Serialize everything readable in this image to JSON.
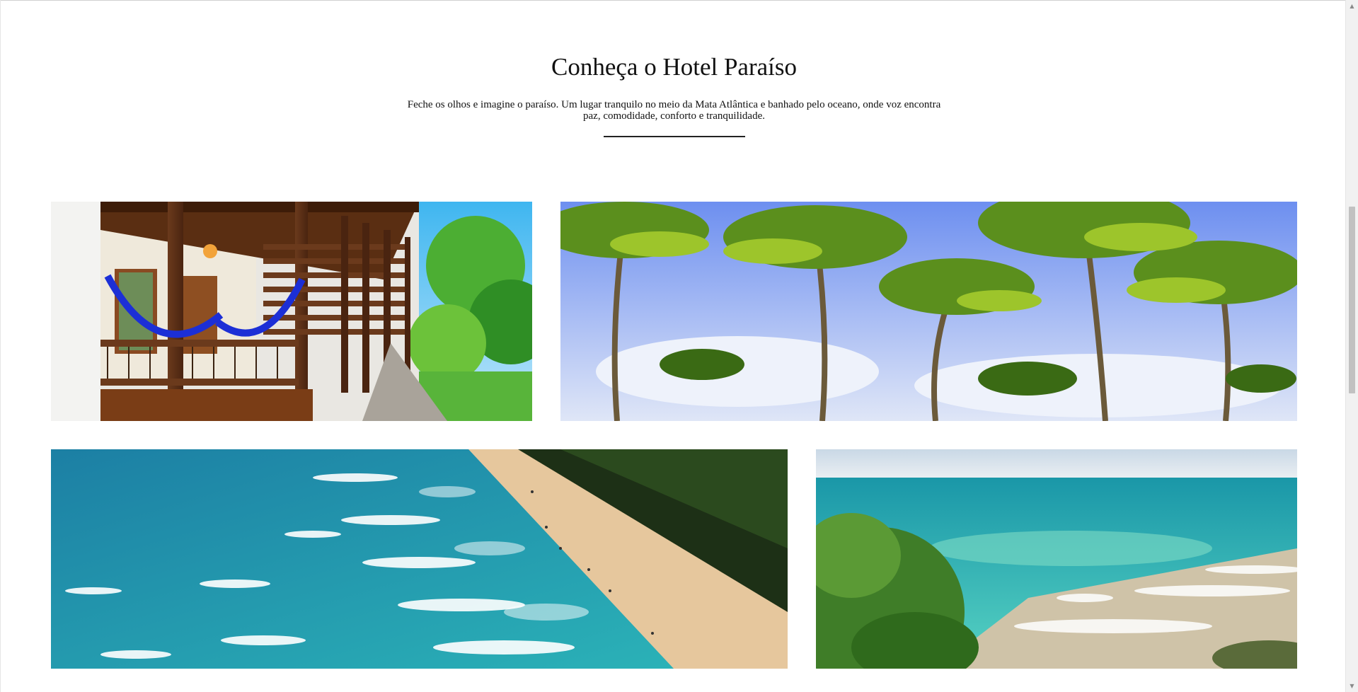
{
  "section": {
    "title": "Conheça o Hotel Paraíso",
    "description": "Feche os olhos e imagine o paraíso. Um lugar tranquilo no meio da Mata Atlântica e banhado pelo oceano, onde voz encontra paz, comodidade, conforto e tranquilidade."
  },
  "gallery": {
    "images": [
      {
        "name": "hotel-veranda-photo"
      },
      {
        "name": "coconut-palms-photo"
      },
      {
        "name": "aerial-beach-photo"
      },
      {
        "name": "turquoise-bay-photo"
      }
    ]
  },
  "scrollbar": {
    "up_icon": "▲",
    "down_icon": "▼"
  }
}
